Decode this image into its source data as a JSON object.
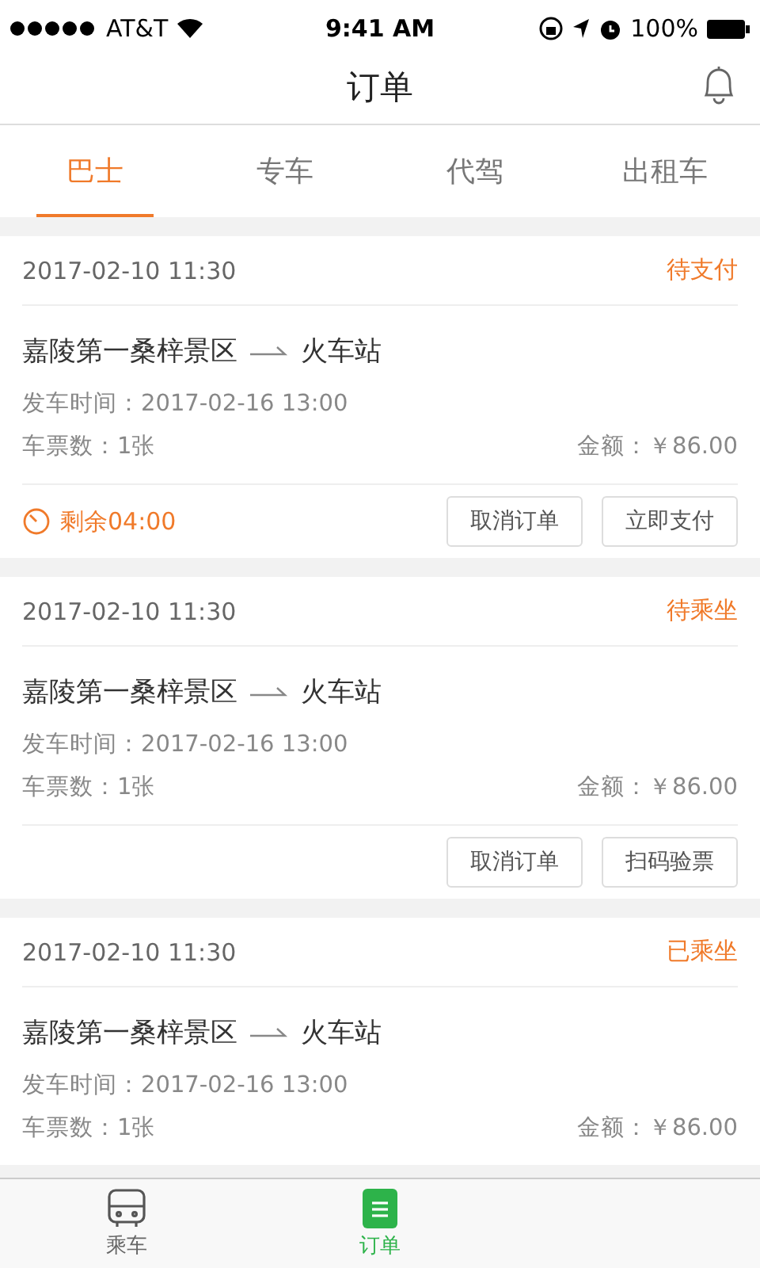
{
  "status_bar": {
    "carrier": "AT&T",
    "time": "9:41 AM",
    "battery": "100%"
  },
  "nav": {
    "title": "订单"
  },
  "tabs": [
    {
      "label": "巴士",
      "selected": true
    },
    {
      "label": "专车",
      "selected": false
    },
    {
      "label": "代驾",
      "selected": false
    },
    {
      "label": "出租车",
      "selected": false
    }
  ],
  "orders": [
    {
      "date": "2017-02-10 11:30",
      "status": "待支付",
      "from": "嘉陵第一桑梓景区",
      "to": "火车站",
      "departure": "发车时间：2017-02-16 13:00",
      "tickets": "车票数：1张",
      "amount": "金额：￥86.00",
      "timer": "剩余04:00",
      "buttons": [
        "取消订单",
        "立即支付"
      ]
    },
    {
      "date": "2017-02-10 11:30",
      "status": "待乘坐",
      "from": "嘉陵第一桑梓景区",
      "to": "火车站",
      "departure": "发车时间：2017-02-16 13:00",
      "tickets": "车票数：1张",
      "amount": "金额：￥86.00",
      "buttons": [
        "取消订单",
        "扫码验票"
      ]
    },
    {
      "date": "2017-02-10 11:30",
      "status": "已乘坐",
      "from": "嘉陵第一桑梓景区",
      "to": "火车站",
      "departure": "发车时间：2017-02-16 13:00",
      "tickets": "车票数：1张",
      "amount": "金额：￥86.00"
    }
  ],
  "tab_bar": [
    {
      "label": "乘车",
      "kind": "bus",
      "selected": false
    },
    {
      "label": "订单",
      "kind": "orders",
      "selected": true
    }
  ]
}
